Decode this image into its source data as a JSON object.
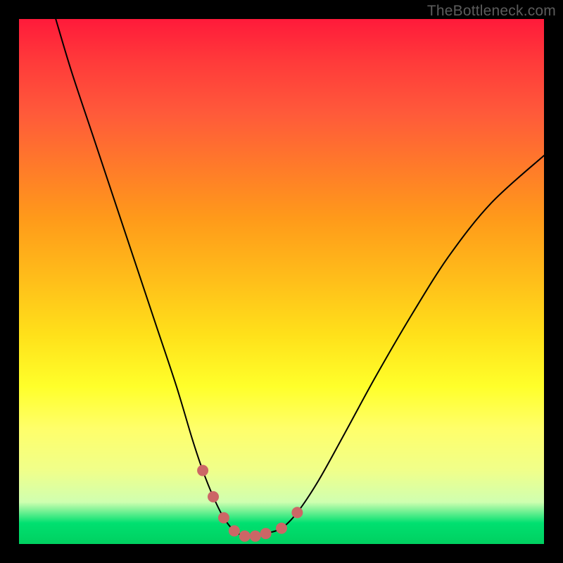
{
  "watermark": "TheBottleneck.com",
  "chart_data": {
    "type": "line",
    "title": "",
    "xlabel": "",
    "ylabel": "",
    "xlim": [
      0,
      100
    ],
    "ylim": [
      0,
      100
    ],
    "grid": false,
    "legend": false,
    "series": [
      {
        "name": "bottleneck-curve",
        "x": [
          7,
          10,
          14,
          18,
          22,
          26,
          30,
          33,
          35,
          37,
          39,
          41,
          43,
          45,
          47,
          50,
          53,
          57,
          62,
          68,
          75,
          82,
          90,
          100
        ],
        "values": [
          100,
          90,
          78,
          66,
          54,
          42,
          30,
          20,
          14,
          9,
          5,
          2.5,
          1.5,
          1.5,
          2,
          3,
          6,
          12,
          21,
          32,
          44,
          55,
          65,
          74
        ],
        "note": "values = height from bottom in % of plot height; optimum (zero bottleneck) around x≈44"
      }
    ],
    "markers": {
      "name": "highlighted-range",
      "color": "#cc6666",
      "radius_px": 8,
      "x": [
        35,
        37,
        39,
        41,
        43,
        45,
        47,
        50,
        53
      ],
      "values": [
        14,
        9,
        5,
        2.5,
        1.5,
        1.5,
        2,
        3,
        6
      ]
    },
    "background_gradient": {
      "type": "vertical",
      "meaning": "red=high bottleneck, green=low bottleneck",
      "stops": [
        {
          "pos": 0.0,
          "color": "#ff1a3a"
        },
        {
          "pos": 0.5,
          "color": "#ffbf1a"
        },
        {
          "pos": 0.7,
          "color": "#ffff2a"
        },
        {
          "pos": 0.96,
          "color": "#00e070"
        },
        {
          "pos": 1.0,
          "color": "#00d060"
        }
      ]
    }
  }
}
